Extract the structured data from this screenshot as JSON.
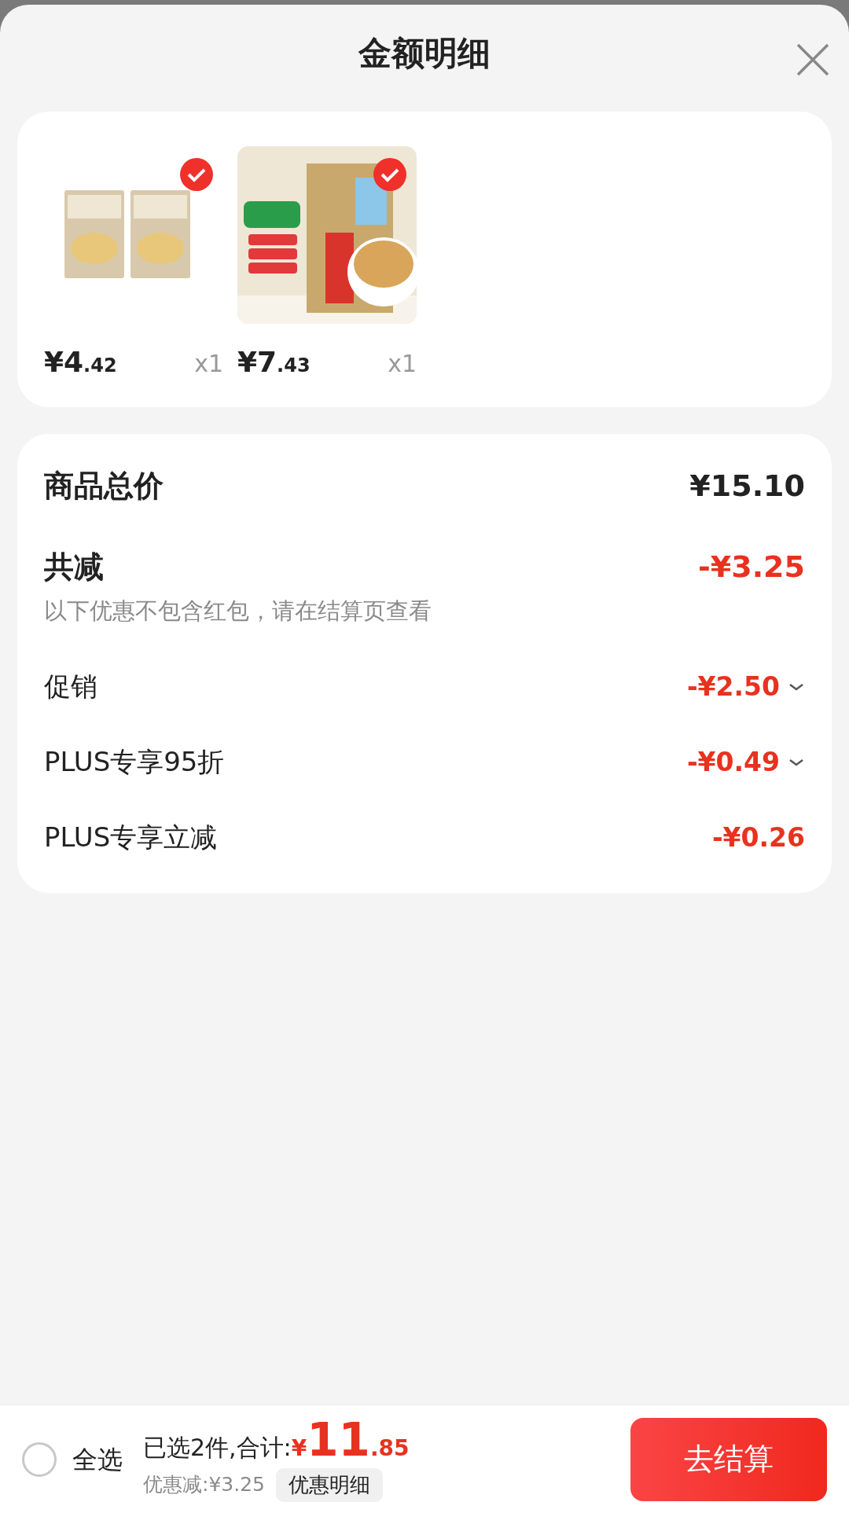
{
  "sheet": {
    "title": "金额明细"
  },
  "items": [
    {
      "kind": "picture",
      "price_main": "¥4",
      "price_cents": ".42",
      "quantity": "x1",
      "checked": true
    },
    {
      "kind": "picture",
      "price_main": "¥7",
      "price_cents": ".43",
      "quantity": "x1",
      "checked": true
    }
  ],
  "summary": {
    "total_label": "商品总价",
    "total_value": "¥15.10",
    "reduce_label": "共减",
    "reduce_value": "-¥3.25",
    "note": "以下优惠不包含红包，请在结算页查看",
    "discounts": [
      {
        "label": "促销",
        "value": "-¥2.50",
        "expandable": true
      },
      {
        "label": "PLUS专享95折",
        "value": "-¥0.49",
        "expandable": true
      },
      {
        "label": "PLUS专享立减",
        "value": "-¥0.26",
        "expandable": false
      }
    ]
  },
  "footer": {
    "select_all": {
      "label": "全选",
      "checked": false
    },
    "selected_text": "已选2件,合计:",
    "currency": "¥",
    "total_main": "11",
    "total_cents": ".85",
    "saved": "优惠减:¥3.25",
    "detail_button": "优惠明细",
    "checkout_button": "去结算"
  }
}
